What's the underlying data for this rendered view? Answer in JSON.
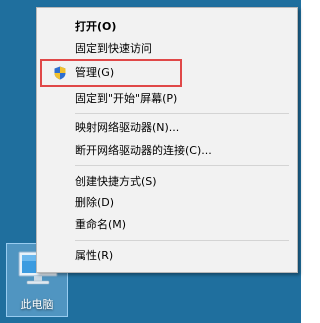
{
  "desktop": {
    "background_color": "#1f6f9e",
    "this_pc": {
      "icon": "computer-icon",
      "label": "此电脑"
    }
  },
  "context_menu": {
    "groups": [
      {
        "items": [
          {
            "label": "打开(O)",
            "bold": true
          },
          {
            "label": "固定到快速访问"
          },
          {
            "label": "管理(G)",
            "icon": "uac-shield-icon",
            "highlighted": true
          },
          {
            "label": "固定到\"开始\"屏幕(P)"
          }
        ]
      },
      {
        "items": [
          {
            "label": "映射网络驱动器(N)..."
          },
          {
            "label": "断开网络驱动器的连接(C)..."
          }
        ]
      },
      {
        "items": [
          {
            "label": "创建快捷方式(S)"
          },
          {
            "label": "删除(D)"
          },
          {
            "label": "重命名(M)"
          }
        ]
      },
      {
        "items": [
          {
            "label": "属性(R)"
          }
        ]
      }
    ],
    "highlight_color": "#e04848"
  }
}
